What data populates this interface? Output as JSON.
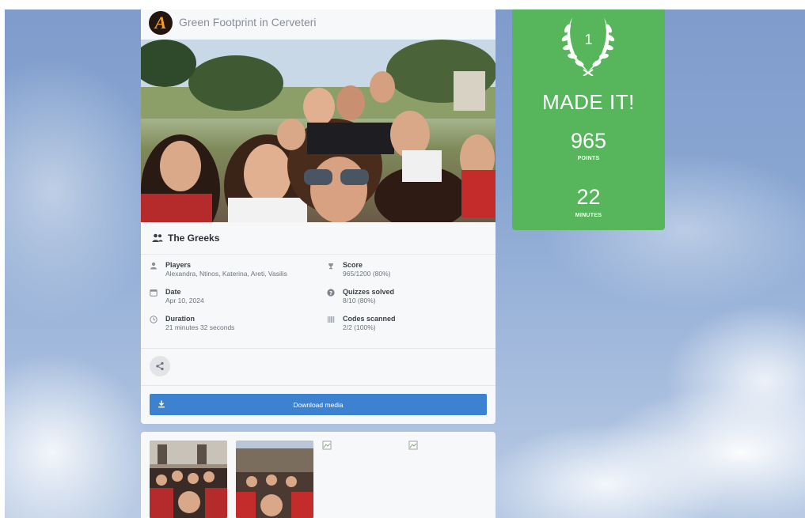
{
  "header": {
    "logo_icon": "orange-A-logo",
    "title": "Green Footprint in Cerveteri"
  },
  "team": {
    "icon": "users-icon",
    "name": "The Greeks"
  },
  "stats": {
    "players": {
      "label": "Players",
      "value": "Alexandra, Ntinos, Katerina, Areti, Vasilis",
      "icon": "user-icon"
    },
    "date": {
      "label": "Date",
      "value": "Apr 10, 2024",
      "icon": "calendar-icon"
    },
    "duration": {
      "label": "Duration",
      "value": "21 minutes 32 seconds",
      "icon": "clock-icon"
    },
    "score": {
      "label": "Score",
      "value": "965/1200 (80%)",
      "icon": "trophy-icon"
    },
    "quizzes": {
      "label": "Quizzes solved",
      "value": "8/10 (80%)",
      "icon": "question-icon"
    },
    "codes": {
      "label": "Codes scanned",
      "value": "2/2 (100%)",
      "icon": "qrcode-icon"
    }
  },
  "actions": {
    "share_icon": "share-icon",
    "download_label": "Download media",
    "download_icon": "download-icon"
  },
  "result": {
    "rank": "1",
    "headline": "MADE IT!",
    "points": "965",
    "points_label": "POINTS",
    "minutes": "22",
    "minutes_label": "MINUTES",
    "color": "#57b65c"
  },
  "gallery": {
    "items": [
      {
        "type": "photo"
      },
      {
        "type": "photo"
      },
      {
        "type": "broken-image"
      },
      {
        "type": "broken-image"
      }
    ]
  },
  "colors": {
    "download_button": "#3d82d1",
    "brand_orange": "#f39a2b"
  }
}
